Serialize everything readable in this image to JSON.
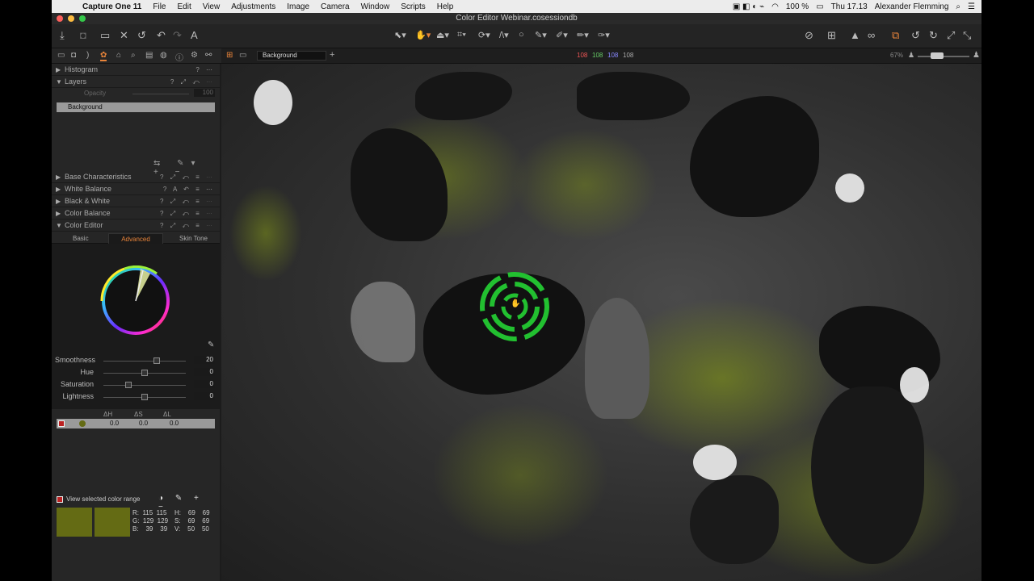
{
  "menubar": {
    "app": "Capture One 11",
    "items": [
      "File",
      "Edit",
      "View",
      "Adjustments",
      "Image",
      "Camera",
      "Window",
      "Scripts",
      "Help"
    ],
    "battery": "100 %",
    "clock": "Thu 17.13",
    "user": "Alexander Flemming"
  },
  "window": {
    "title": "Color Editor Webinar.cosessiondb"
  },
  "viewer": {
    "variant": "Background",
    "values": {
      "r": "108",
      "g": "108",
      "b": "108",
      "l": "108"
    },
    "zoom": "67%"
  },
  "panel": {
    "histogram": "Histogram",
    "layers": {
      "title": "Layers",
      "opacity_label": "Opacity",
      "opacity_value": "100",
      "layer": "Background"
    },
    "tools": [
      "Base Characteristics",
      "White Balance",
      "Black & White",
      "Color Balance",
      "Color Editor"
    ],
    "tool_ctrls": "? ⤢ ↶ ≡ ⋯",
    "wb_ctrls": "? A ↶ ≡ ⋯",
    "ce_tabs": [
      "Basic",
      "Advanced",
      "Skin Tone"
    ],
    "sliders": [
      {
        "label": "Smoothness",
        "value": "20",
        "pos": 0.65
      },
      {
        "label": "Hue",
        "value": "0",
        "pos": 0.5
      },
      {
        "label": "Saturation",
        "value": "0",
        "pos": 0.3
      },
      {
        "label": "Lightness",
        "value": "0",
        "pos": 0.5
      }
    ],
    "delta_headers": [
      "ΔH",
      "ΔS",
      "ΔL"
    ],
    "delta_values": [
      "0.0",
      "0.0",
      "0.0"
    ],
    "view_range_label": "View selected color range",
    "readout": {
      "r": "R:  115  115",
      "g": "G:  129  129",
      "b": "B:    39    39",
      "h": "H:    69    69",
      "s": "S:    69    69",
      "v": "V:    50    50"
    }
  },
  "colors": {
    "accent": "#e8843a",
    "swatch": "#646b14",
    "selection": "#9a9a9a"
  }
}
